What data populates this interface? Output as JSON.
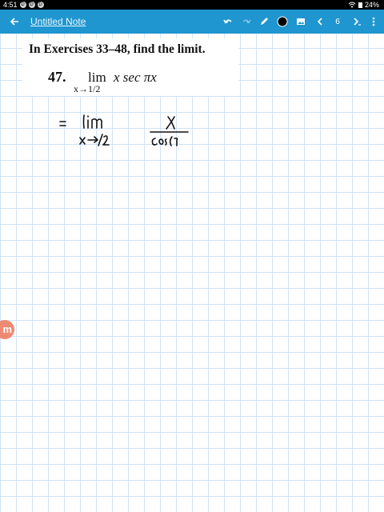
{
  "status_bar": {
    "time": "4:51",
    "indicator_letters": [
      "D",
      "D",
      "D"
    ],
    "battery": "24%"
  },
  "toolbar": {
    "title": "Untitled Note",
    "page_number": "6",
    "color": "#1f96cf",
    "icons": [
      "back-arrow-icon",
      "undo-icon",
      "redo-icon",
      "pen-icon",
      "color-dot-icon",
      "image-icon",
      "prev-page-icon",
      "next-page-icon",
      "more-icon"
    ]
  },
  "note": {
    "instructions": "In Exercises 33–48, find the limit.",
    "exercise_number": "47.",
    "lim_word": "lim",
    "lim_subscript": "x→1/2",
    "expression": "x sec πx"
  },
  "handwriting_strokes": [
    "=",
    "lim",
    "x→1/2",
    "x",
    "cos(π"
  ],
  "side_badge": "m"
}
